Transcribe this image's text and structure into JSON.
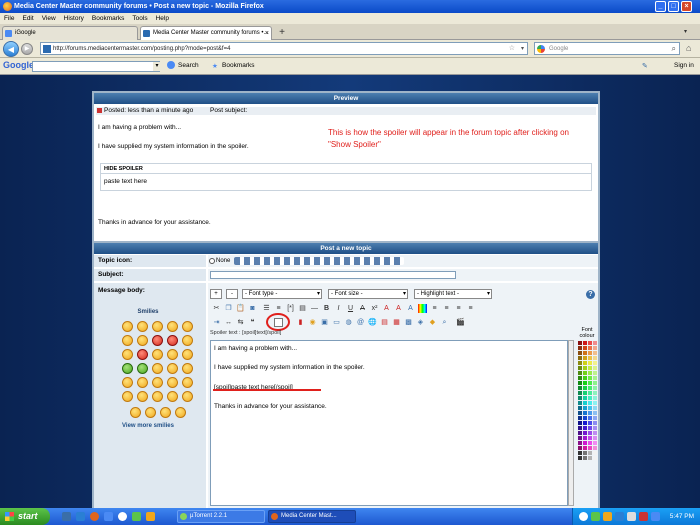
{
  "window": {
    "title": "Media Center Master community forums • Post a new topic - Mozilla Firefox"
  },
  "menu": [
    "File",
    "Edit",
    "View",
    "History",
    "Bookmarks",
    "Tools",
    "Help"
  ],
  "tabs": [
    {
      "label": "iGoogle"
    },
    {
      "label": "Media Center Master community forums •..."
    }
  ],
  "nav": {
    "url": "http://forums.mediacentermaster.com/posting.php?mode=post&f=4",
    "search_placeholder": "Google"
  },
  "googlebar": {
    "logo": "Google",
    "search_label": "Search",
    "bookmarks_label": "Bookmarks",
    "signin_label": "Sign in"
  },
  "preview": {
    "header": "Preview",
    "posted_label": "Posted: less than a minute ago",
    "subject_label": "Post subject:",
    "line1": "I am having a problem with...",
    "line2": "I have supplied my system information in the spoiler.",
    "annotation": "This is how the spoiler will appear in the forum topic after clicking on \"Show Spoiler\"",
    "hide_spoiler": "HIDE SPOILER",
    "spoiler_content": "paste text here",
    "thanks": "Thanks in advance for your assistance."
  },
  "post": {
    "header": "Post a new topic",
    "topic_icon_label": "Topic icon:",
    "none_label": "None",
    "subject_label": "Subject:",
    "body_label": "Message body:",
    "font_type": "- Font type -",
    "font_size": "- Font size -",
    "highlight": "- Highlight text -",
    "spoiler_hint": "Spoiler text : [spoil]text[/spoil]",
    "smilies_label": "Smilies",
    "view_more": "View more smilies",
    "font_colour": "Font colour",
    "editor_lines": [
      "I am having a problem with...",
      "",
      "I have supplied my system information in the spoiler.",
      "",
      "[spoil]paste text here[/spoil]",
      "",
      "Thanks in advance for your assistance."
    ]
  },
  "taskbar": {
    "start": "start",
    "tasks": [
      {
        "label": "µTorrent 2.2.1"
      },
      {
        "label": "Media Center Mast..."
      }
    ],
    "clock": "5:47 PM"
  },
  "colors": {
    "panel_header": "#1f4f86",
    "annotation": "#e0201c",
    "highlight_circle": "#e0201c",
    "taskbar": "#1d58d0"
  }
}
